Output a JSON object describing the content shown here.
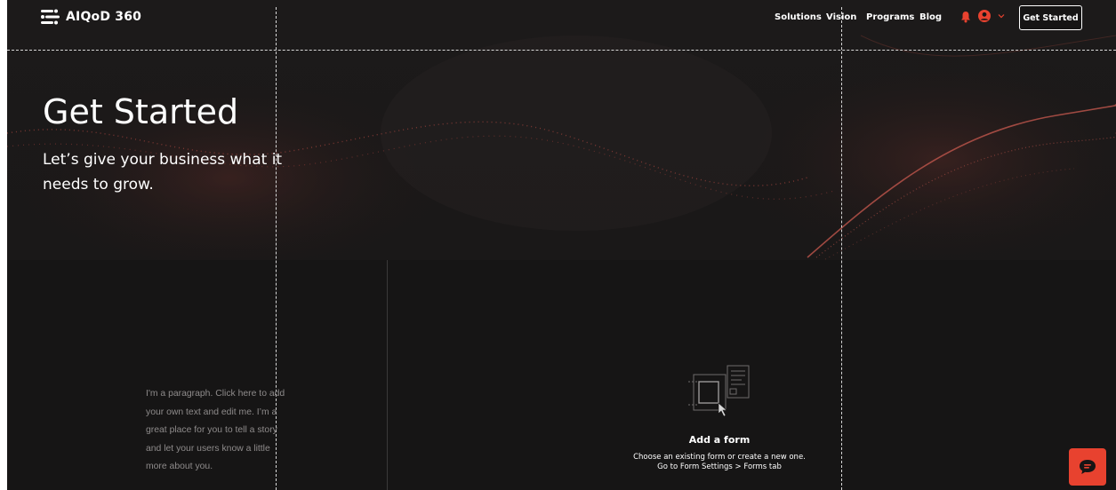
{
  "header": {
    "brand": "AIQoD 360",
    "nav": [
      "Solutions",
      "Vision",
      "Programs",
      "Blog"
    ],
    "cta_label": "Get Started"
  },
  "hero": {
    "title": "Get Started",
    "subtitle": "Let’s give your business what it needs to grow."
  },
  "content": {
    "paragraph": "I'm a paragraph. Click here to add your own text and edit me. I’m a great place for you to tell a story and let your users know a little more about you."
  },
  "form_placeholder": {
    "title": "Add a form",
    "line1": "Choose an existing form or create a new one.",
    "line2": "Go to Form Settings > Forms tab"
  },
  "icons": {
    "logo": "logo-icon",
    "notification": "bell-icon",
    "account": "user-icon",
    "menu": "chevron-down-icon",
    "chat": "chat-icon",
    "form": "form-illustration-icon"
  },
  "colors": {
    "background": "#161515",
    "accent": "#e8422f",
    "text": "#ffffff",
    "muted_text": "#8e8b8b"
  }
}
